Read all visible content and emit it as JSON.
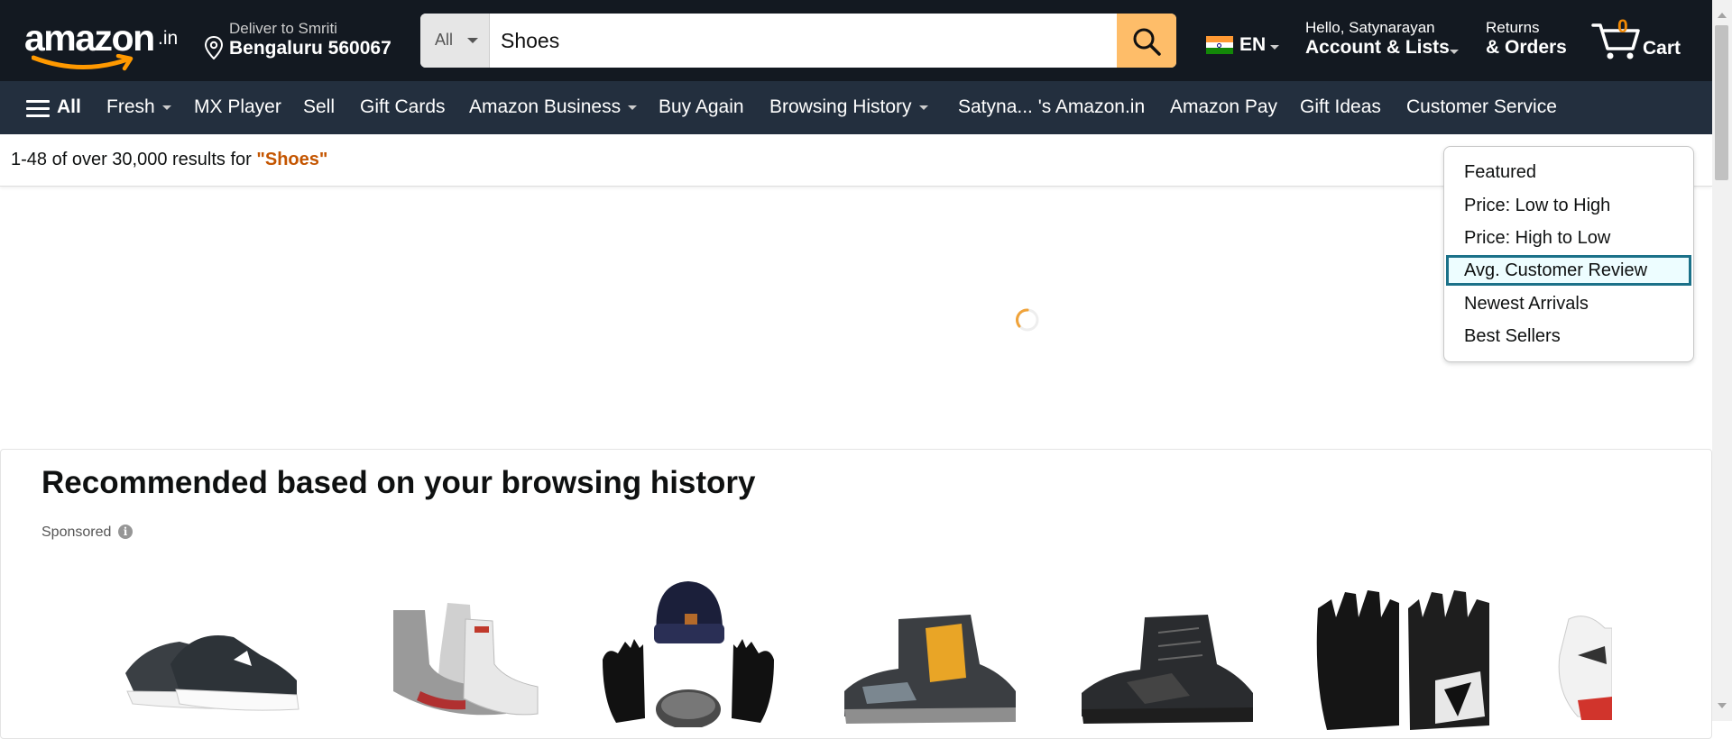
{
  "header": {
    "logo_text": "amazon",
    "logo_tld": ".in",
    "deliver_line1": "Deliver to Smriti",
    "deliver_line2": "Bengaluru 560067",
    "search_category": "All",
    "search_value": "Shoes",
    "language": "EN",
    "account_line1": "Hello, Satynarayan",
    "account_line2": "Account & Lists",
    "orders_line1": "Returns",
    "orders_line2": "& Orders",
    "cart_count": "0",
    "cart_label": "Cart"
  },
  "nav": {
    "all_label": "All",
    "items": [
      {
        "label": "Fresh",
        "has_caret": true
      },
      {
        "label": "MX Player"
      },
      {
        "label": "Sell"
      },
      {
        "label": "Gift Cards"
      },
      {
        "label": "Amazon Business",
        "has_caret": true
      },
      {
        "label": "Buy Again"
      },
      {
        "label": "Browsing History",
        "has_caret": true
      },
      {
        "label": "Satyna... 's Amazon.in"
      },
      {
        "label": "Amazon Pay"
      },
      {
        "label": "Gift Ideas"
      },
      {
        "label": "Customer Service"
      }
    ]
  },
  "results": {
    "prefix": "1-48 of over 30,000 results for ",
    "query": "\"Shoes\""
  },
  "sort_menu": {
    "options": [
      "Featured",
      "Price: Low to High",
      "Price: High to Low",
      "Avg. Customer Review",
      "Newest Arrivals",
      "Best Sellers"
    ],
    "highlighted": "Avg. Customer Review"
  },
  "recommendations": {
    "title": "Recommended based on your browsing history",
    "sponsored_label": "Sponsored",
    "products": [
      "running-shoes",
      "ankle-socks",
      "winter-cap-gloves-set",
      "hiking-boot-yellow",
      "hiking-boot-black",
      "gym-gloves",
      "sports-shoe-partial"
    ]
  },
  "colors": {
    "header_bg": "#131921",
    "nav_bg": "#232f3e",
    "search_button": "#febd69",
    "query_color": "#c45500",
    "highlight_border": "#1b7189",
    "cart_count": "#f08804"
  }
}
